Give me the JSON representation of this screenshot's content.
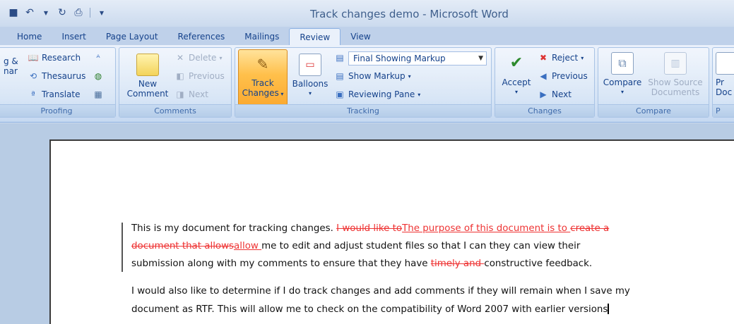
{
  "window": {
    "title": "Track changes demo - Microsoft Word"
  },
  "tabs": [
    "Home",
    "Insert",
    "Page Layout",
    "References",
    "Mailings",
    "Review",
    "View"
  ],
  "active_tab": "Review",
  "proofing": {
    "research": "Research",
    "thesaurus": "Thesaurus",
    "translate": "Translate",
    "spelling_partial_1": "g &",
    "spelling_partial_2": "nar",
    "label": "Proofing"
  },
  "comments": {
    "new_line1": "New",
    "new_line2": "Comment",
    "delete": "Delete",
    "previous": "Previous",
    "next": "Next",
    "label": "Comments"
  },
  "tracking": {
    "track_line1": "Track",
    "track_line2": "Changes",
    "balloons": "Balloons",
    "display_mode": "Final Showing Markup",
    "show_markup": "Show Markup",
    "reviewing_pane": "Reviewing Pane",
    "label": "Tracking"
  },
  "changes": {
    "accept": "Accept",
    "reject": "Reject",
    "previous": "Previous",
    "next": "Next",
    "label": "Changes"
  },
  "compare": {
    "compare": "Compare",
    "show_source_line1": "Show Source",
    "show_source_line2": "Documents",
    "label": "Compare"
  },
  "protect": {
    "btn_line1": "Pr",
    "btn_line2": "Doc",
    "label": "P"
  },
  "document": {
    "p1_l1_a": "This is my document for tracking changes.  ",
    "p1_l1_del": "I would like to",
    "p1_l1_ins": "The purpose of this document is to ",
    "p1_l1_del2": " create a",
    "p1_l2_del": "document that allows",
    "p1_l2_ins": "allow ",
    "p1_l2_b": " me to edit and adjust student files so that I can they can view their",
    "p1_l3_a": "submission along with my comments to ensure that they have ",
    "p1_l3_del": "timely and ",
    "p1_l3_b": "constructive feedback.",
    "p2_l1": "I would also like to determine if I do track changes and add comments if they will remain when I save my",
    "p2_l2": "document as RTF.  This will allow me to check on the compatibility of Word 2007  with earlier versions"
  },
  "colors": {
    "revision": "#e33333",
    "tab_text": "#15428b"
  }
}
